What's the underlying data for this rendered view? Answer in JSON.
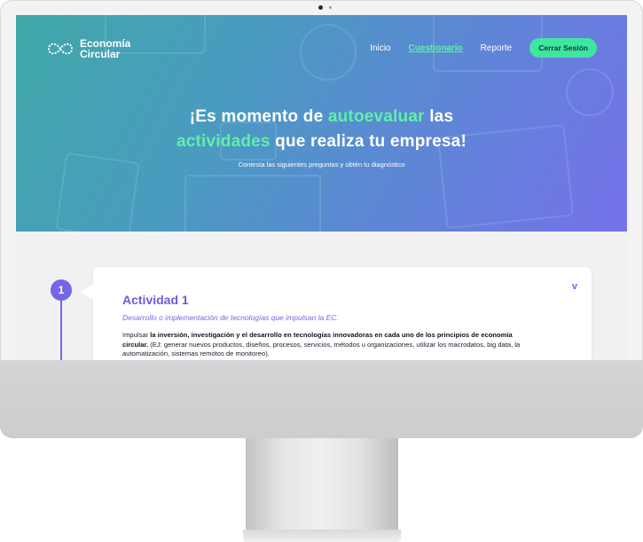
{
  "brand": {
    "name_line1": "Economía",
    "name_line2": "Circular"
  },
  "nav": {
    "items": [
      {
        "label": "Inicio",
        "active": false
      },
      {
        "label": "Cuestionario",
        "active": true
      },
      {
        "label": "Reporte",
        "active": false
      }
    ],
    "logout_label": "Cerrar Sesión"
  },
  "hero": {
    "title_part1": "¡Es momento de ",
    "title_highlight1": "autoevaluar",
    "title_part2": " las",
    "title_highlight2": "actividades",
    "title_part3": " que realiza tu empresa!",
    "subtitle": "Contesta las siguientes preguntas y obtén tu diagnóstico"
  },
  "activity": {
    "number": "1",
    "title": "Actividad 1",
    "subtitle": "Desarrollo o implementación de tecnologías que impulsan la EC.",
    "body_lead": "Impulsar ",
    "body_bold": "la inversión, investigación y el desarrollo en tecnologías innovadoras en cada uno de los principios de economía circular.",
    "body_rest": " (EJ: generar nuevos productos, diseños, procesos, servicios, métodos u organizaciones, utilizar los macrodatos, big data, la automatización, sistemas remotos de monitoreo).",
    "toggle_icon": "chevron-down-icon"
  },
  "colors": {
    "accent_green": "#3ee6a0",
    "accent_purple": "#7366e6"
  }
}
